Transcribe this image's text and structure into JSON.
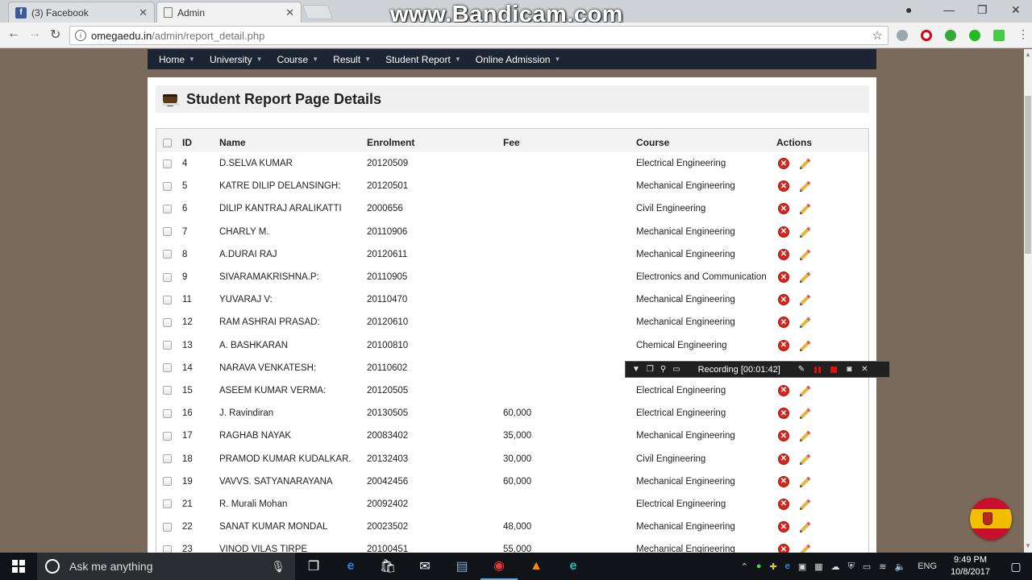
{
  "browser": {
    "tabs": [
      {
        "title": "(3) Facebook",
        "favicon": "facebook-icon"
      },
      {
        "title": "Admin",
        "favicon": "page-icon"
      }
    ],
    "watermark": "www.Bandicam.com",
    "url_host": "omegaedu.in",
    "url_path": "/admin/report_detail.php"
  },
  "nav": {
    "items": [
      "Home",
      "University",
      "Course",
      "Result",
      "Student Report",
      "Online Admission"
    ]
  },
  "page": {
    "title": "Student Report Page Details"
  },
  "table": {
    "headers": {
      "id": "ID",
      "name": "Name",
      "enrolment": "Enrolment",
      "fee": "Fee",
      "course": "Course",
      "actions": "Actions"
    },
    "rows": [
      {
        "id": "4",
        "name": "D.SELVA KUMAR",
        "enrolment": "20120509",
        "fee": "",
        "course": "Electrical Engineering"
      },
      {
        "id": "5",
        "name": "KATRE DILIP DELANSINGH:",
        "enrolment": "20120501",
        "fee": "",
        "course": "Mechanical Engineering"
      },
      {
        "id": "6",
        "name": "DILIP KANTRAJ ARALIKATTI",
        "enrolment": "2000656",
        "fee": "",
        "course": "Civil Engineering"
      },
      {
        "id": "7",
        "name": "CHARLY M.",
        "enrolment": "20110906",
        "fee": "",
        "course": "Mechanical Engineering"
      },
      {
        "id": "8",
        "name": "A.DURAI RAJ",
        "enrolment": "20120611",
        "fee": "",
        "course": "Mechanical Engineering"
      },
      {
        "id": "9",
        "name": "SIVARAMAKRISHNA.P:",
        "enrolment": "20110905",
        "fee": "",
        "course": "Electronics and Communication"
      },
      {
        "id": "11",
        "name": "YUVARAJ V:",
        "enrolment": "20110470",
        "fee": "",
        "course": "Mechanical Engineering"
      },
      {
        "id": "12",
        "name": "RAM ASHRAI PRASAD:",
        "enrolment": "20120610",
        "fee": "",
        "course": "Mechanical Engineering"
      },
      {
        "id": "13",
        "name": "A. BASHKARAN",
        "enrolment": "20100810",
        "fee": "",
        "course": "Chemical Engineering"
      },
      {
        "id": "14",
        "name": "NARAVA VENKATESH:",
        "enrolment": "20110602",
        "fee": "",
        "course": ""
      },
      {
        "id": "15",
        "name": "ASEEM KUMAR VERMA:",
        "enrolment": "20120505",
        "fee": "",
        "course": "Electrical Engineering"
      },
      {
        "id": "16",
        "name": "J. Ravindiran",
        "enrolment": "20130505",
        "fee": "60,000",
        "course": "Electrical Engineering"
      },
      {
        "id": "17",
        "name": "RAGHAB NAYAK",
        "enrolment": "20083402",
        "fee": "35,000",
        "course": "Mechanical Engineering"
      },
      {
        "id": "18",
        "name": "PRAMOD KUMAR KUDALKAR.",
        "enrolment": "20132403",
        "fee": "30,000",
        "course": "Civil Engineering"
      },
      {
        "id": "19",
        "name": "VAVVS. SATYANARAYANA",
        "enrolment": "20042456",
        "fee": "60,000",
        "course": "Mechanical Engineering"
      },
      {
        "id": "21",
        "name": "R. Murali Mohan",
        "enrolment": "20092402",
        "fee": "",
        "course": "Electrical Engineering"
      },
      {
        "id": "22",
        "name": "SANAT KUMAR MONDAL",
        "enrolment": "20023502",
        "fee": "48,000",
        "course": "Mechanical Engineering"
      },
      {
        "id": "23",
        "name": "VINOD VILAS TIRPE",
        "enrolment": "20100451",
        "fee": "55,000",
        "course": "Mechanical Engineering"
      }
    ]
  },
  "recorder": {
    "label": "Recording [00:01:42]"
  },
  "taskbar": {
    "search_placeholder": "Ask me anything",
    "language": "ENG",
    "time": "9:49 PM",
    "date": "10/8/2017"
  }
}
